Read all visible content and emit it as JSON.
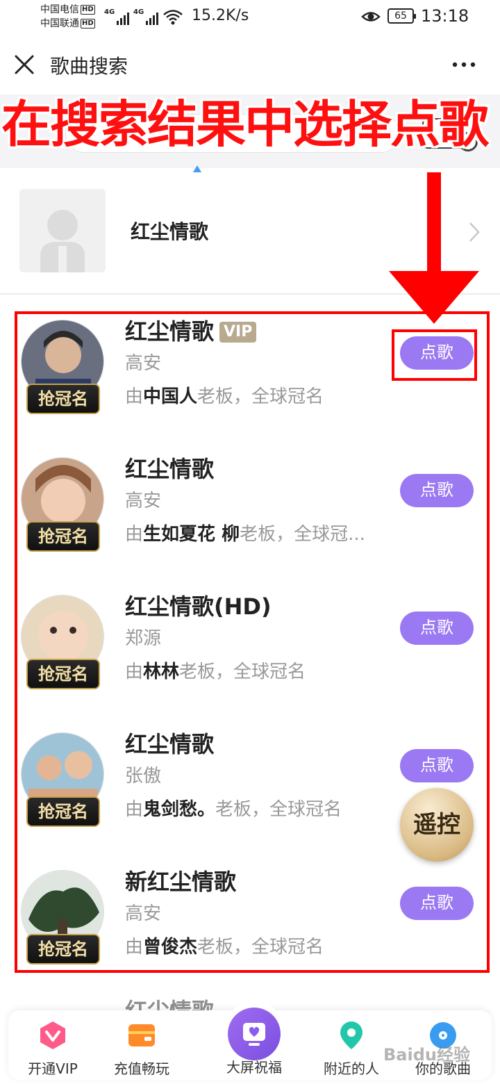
{
  "status_bar": {
    "carrier1": "中国电信",
    "carrier2": "中国联通",
    "hd": "HD",
    "net_gen": "4G",
    "net_speed": "15.2K/s",
    "battery": "65",
    "time": "13:18"
  },
  "header": {
    "title": "歌曲搜索"
  },
  "annotation": {
    "overlay_text": "在搜索结果中选择点歌"
  },
  "singer": {
    "name": "红尘情歌"
  },
  "songs": [
    {
      "title": "红尘情歌",
      "vip": "VIP",
      "artist": "高安",
      "sponsor_prefix": "由",
      "sponsor": "中国人",
      "sponsor_suffix": "老板，全球冠名",
      "badge": "抢冠名",
      "button": "点歌"
    },
    {
      "title": "红尘情歌",
      "vip": "",
      "artist": "高安",
      "sponsor_prefix": "由",
      "sponsor": "生如夏花 柳",
      "sponsor_suffix": "老板，全球冠...",
      "badge": "抢冠名",
      "button": "点歌"
    },
    {
      "title": "红尘情歌(HD)",
      "vip": "",
      "artist": "郑源",
      "sponsor_prefix": "由",
      "sponsor": "林林",
      "sponsor_suffix": "老板，全球冠名",
      "badge": "抢冠名",
      "button": "点歌"
    },
    {
      "title": "红尘情歌",
      "vip": "",
      "artist": "张傲",
      "sponsor_prefix": "由",
      "sponsor": "鬼剑愁。",
      "sponsor_suffix": "老板，全球冠名",
      "badge": "抢冠名",
      "button": "点歌"
    },
    {
      "title": "新红尘情歌",
      "vip": "",
      "artist": "高安",
      "sponsor_prefix": "由",
      "sponsor": "曾俊杰",
      "sponsor_suffix": "老板，全球冠名",
      "badge": "抢冠名",
      "button": "点歌"
    }
  ],
  "peek_title": "红尘情歌",
  "remote": "遥控",
  "tabs": [
    {
      "label": "开通VIP",
      "icon": "vip-heart-icon",
      "color": "#ff5b8a"
    },
    {
      "label": "充值畅玩",
      "icon": "wallet-icon",
      "color": "#ff8a2a"
    },
    {
      "label": "大屏祝福",
      "icon": "screen-heart-icon",
      "color": "#8a5cf0"
    },
    {
      "label": "附近的人",
      "icon": "location-pin-icon",
      "color": "#22c7a9"
    },
    {
      "label": "你的歌曲",
      "icon": "music-disc-icon",
      "color": "#3a9cf0"
    }
  ],
  "watermark": "Baidu经验",
  "colors": {
    "accent": "#9b79f2",
    "annotation_red": "#ff0000"
  }
}
